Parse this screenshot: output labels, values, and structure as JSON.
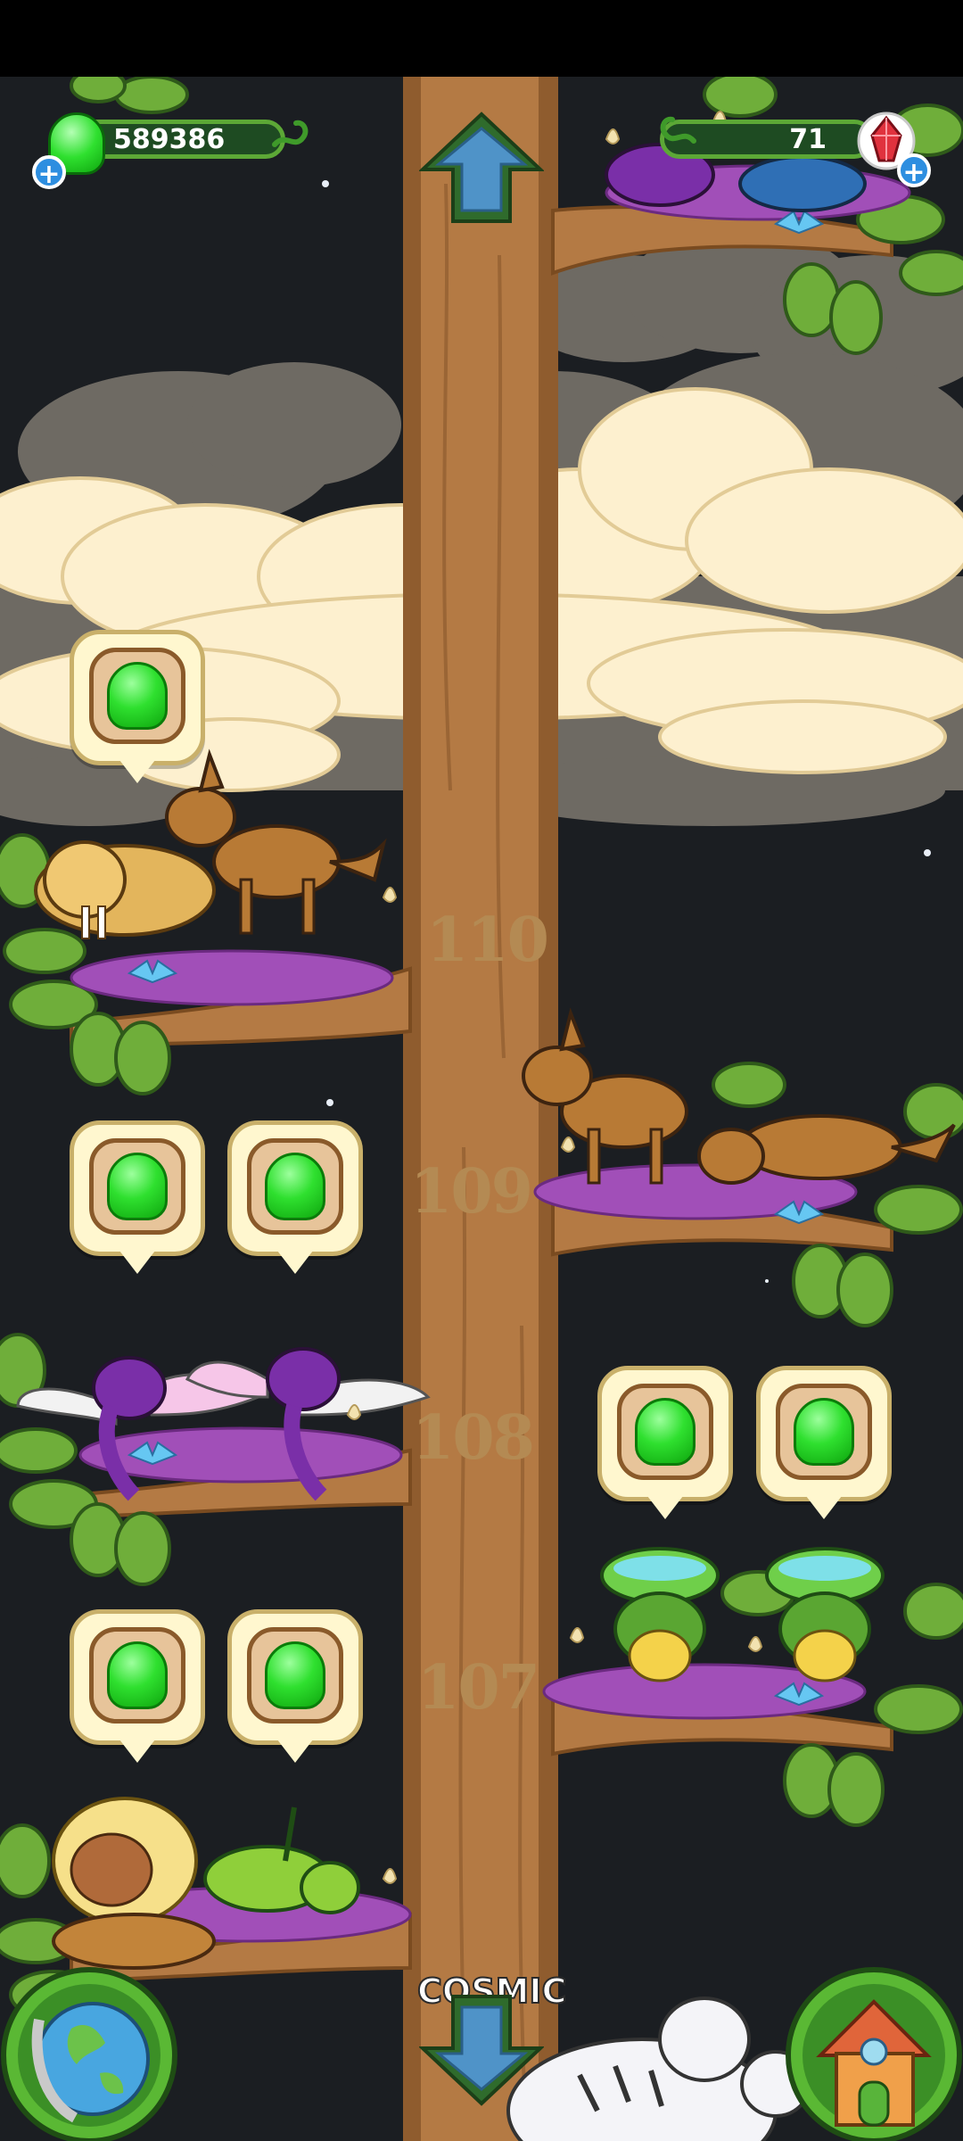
{
  "hud": {
    "currency_value": "589386",
    "gem_value": "71",
    "currency_icon": "green-jelly-icon",
    "gem_icon": "red-crystal-icon",
    "add_symbol": "+"
  },
  "tree": {
    "levels": [
      {
        "number": "110"
      },
      {
        "number": "109"
      },
      {
        "number": "108"
      },
      {
        "number": "107"
      }
    ],
    "tier_label": "COSMIC"
  },
  "nav": {
    "up_icon": "arrow-up-icon",
    "down_icon": "arrow-down-icon",
    "world_icon": "globe-icon",
    "home_icon": "house-icon"
  },
  "colors": {
    "trunk": "#b47a44",
    "sky": "#1b1e22",
    "leaf": "#6fae3a",
    "cloud": "#fdf0cf",
    "jelly": "#2fe02f"
  }
}
